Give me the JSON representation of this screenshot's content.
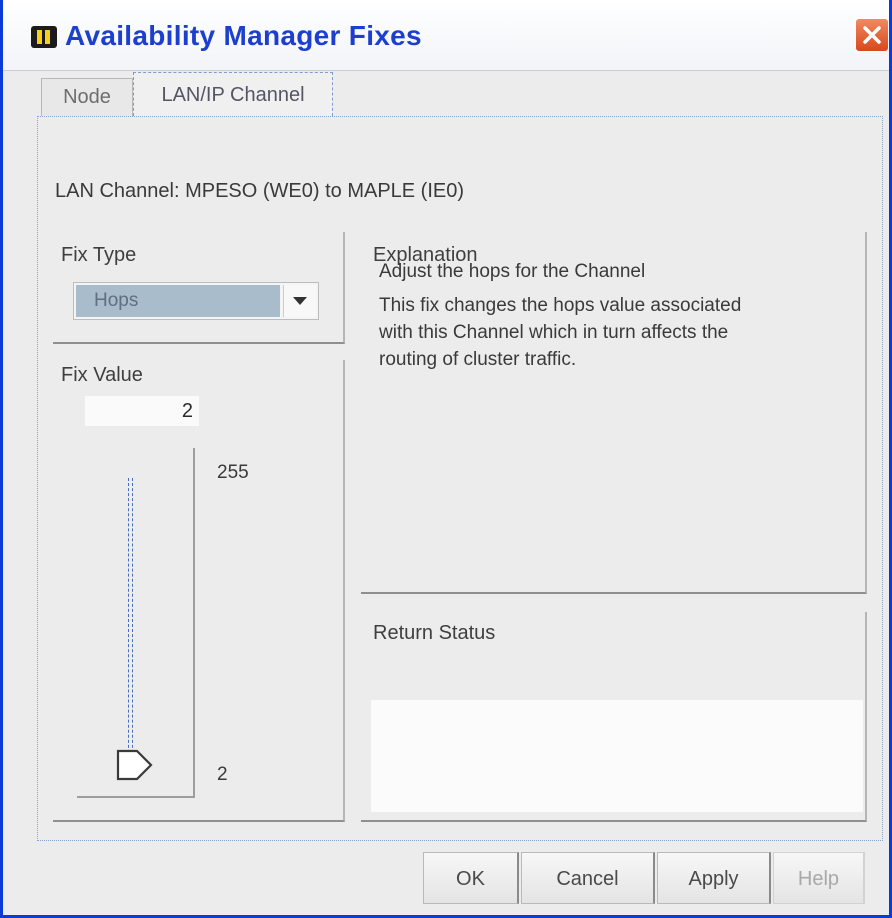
{
  "window": {
    "title": "Availability Manager Fixes"
  },
  "tabs": [
    {
      "label": "Node",
      "active": false
    },
    {
      "label": "LAN/IP Channel",
      "active": true
    }
  ],
  "channel_label": "LAN Channel: MPESO  (WE0) to MAPLE  (IE0)",
  "fix_type": {
    "label": "Fix Type",
    "selected": "Hops"
  },
  "fix_value": {
    "label": "Fix Value",
    "value": "2",
    "max_label": "255",
    "min_label": "2"
  },
  "explanation": {
    "label": "Explanation",
    "heading": "Adjust the hops for the Channel",
    "lines": [
      "This fix changes the hops value associated",
      "with this Channel which in turn affects the",
      "routing of cluster traffic."
    ]
  },
  "return_status": {
    "label": "Return Status",
    "value": ""
  },
  "buttons": {
    "ok": "OK",
    "cancel": "Cancel",
    "apply": "Apply",
    "help": "Help"
  },
  "colors": {
    "title": "#1c3fd0",
    "window_border": "#0a3bd6",
    "close": "#d8481b",
    "dropdown_selected": "#a9bccb"
  }
}
